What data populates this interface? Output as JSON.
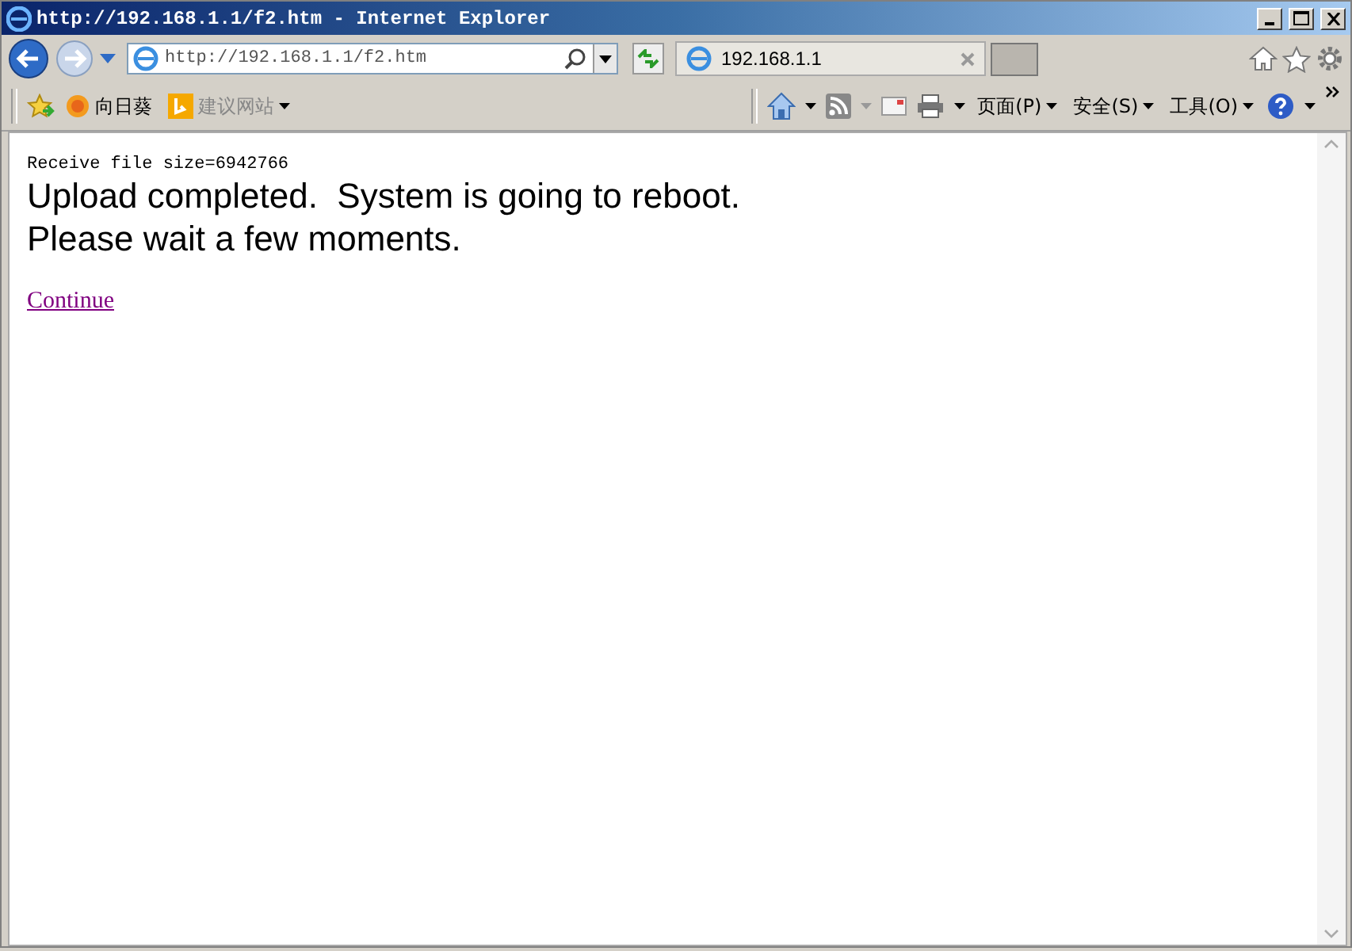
{
  "window": {
    "title": "http://192.168.1.1/f2.htm - Internet Explorer"
  },
  "address_bar": {
    "value": "http://192.168.1.1/f2.htm"
  },
  "tabs": [
    {
      "label": "192.168.1.1",
      "selected": true
    }
  ],
  "favorites_bar": {
    "items": [
      {
        "label": "向日葵",
        "kind": "sunflower"
      },
      {
        "label": "建议网站",
        "kind": "suggested"
      }
    ]
  },
  "command_bar": {
    "menus": [
      {
        "label": "页面(P)"
      },
      {
        "label": "安全(S)"
      },
      {
        "label": "工具(O)"
      }
    ]
  },
  "page": {
    "file_info": "Receive file size=6942766",
    "lines": [
      "Upload completed.  System is going to reboot.",
      "Please wait a few moments."
    ],
    "link": "Continue"
  }
}
